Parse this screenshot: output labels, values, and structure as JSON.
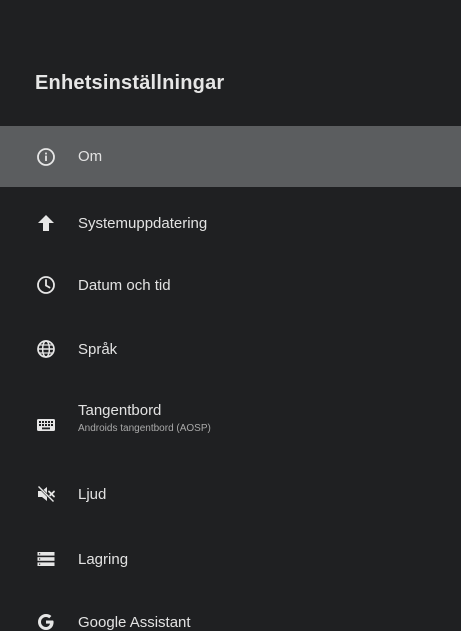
{
  "header": {
    "title": "Enhetsinställningar"
  },
  "menu": {
    "items": [
      {
        "label": "Om",
        "icon": "info-icon",
        "selected": true
      },
      {
        "label": "Systemuppdatering",
        "icon": "arrow-up-icon"
      },
      {
        "label": "Datum och tid",
        "icon": "clock-icon"
      },
      {
        "label": "Språk",
        "icon": "globe-icon"
      },
      {
        "label": "Tangentbord",
        "sublabel": "Androids tangentbord (AOSP)",
        "icon": "keyboard-icon"
      },
      {
        "label": "Ljud",
        "icon": "volume-off-icon"
      },
      {
        "label": "Lagring",
        "icon": "storage-icon"
      },
      {
        "label": "Google Assistant",
        "icon": "google-icon"
      }
    ]
  },
  "colors": {
    "background": "#1f2022",
    "selected": "#5b5d5f",
    "text": "#e2e2e2",
    "subtext": "#a9a9a9"
  }
}
